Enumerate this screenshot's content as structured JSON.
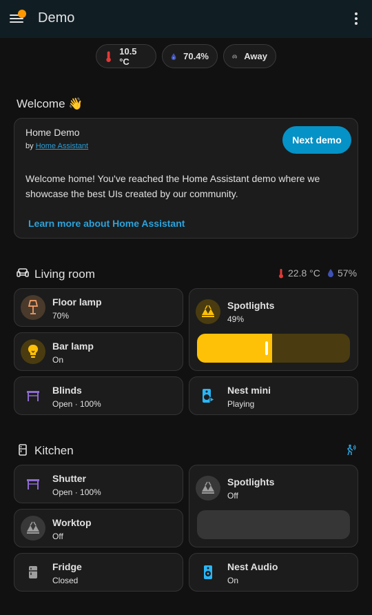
{
  "app": {
    "title": "Demo"
  },
  "badges": [
    {
      "label": "10.5 °C",
      "icon": "thermometer-icon",
      "color": "#e53935"
    },
    {
      "label": "70.4%",
      "icon": "water-drop-icon",
      "color": "#3f51b5"
    },
    {
      "label": "Away",
      "icon": "car-icon",
      "color": "#9e9e9e"
    }
  ],
  "welcome": {
    "heading": "Welcome 👋",
    "card_title": "Home Demo",
    "by_prefix": "by",
    "author": "Home Assistant",
    "next_label": "Next demo",
    "body": "Welcome home! You've reached the Home Assistant demo where we showcase the best UIs created by our community.",
    "learn_more": "Learn more about Home Assistant"
  },
  "living_room": {
    "title": "Living room",
    "temperature": "22.8 °C",
    "humidity": "57%",
    "tiles": {
      "floor_lamp": {
        "name": "Floor lamp",
        "state": "70%"
      },
      "bar_lamp": {
        "name": "Bar lamp",
        "state": "On"
      },
      "blinds": {
        "name": "Blinds",
        "state": "Open · 100%"
      },
      "spotlights": {
        "name": "Spotlights",
        "state": "49%",
        "brightness_pct": 49
      },
      "nest_mini": {
        "name": "Nest mini",
        "state": "Playing"
      }
    }
  },
  "kitchen": {
    "title": "Kitchen",
    "tiles": {
      "shutter": {
        "name": "Shutter",
        "state": "Open · 100%"
      },
      "worktop": {
        "name": "Worktop",
        "state": "Off"
      },
      "fridge": {
        "name": "Fridge",
        "state": "Closed"
      },
      "spotlights": {
        "name": "Spotlights",
        "state": "Off",
        "brightness_pct": 0
      },
      "nest_audio": {
        "name": "Nest Audio",
        "state": "On"
      }
    }
  },
  "colors": {
    "accent": "#0592c6",
    "light_on": "#ffc107",
    "cover": "#8e6bd1",
    "media": "#29b6f6",
    "off": "#9e9e9e"
  }
}
